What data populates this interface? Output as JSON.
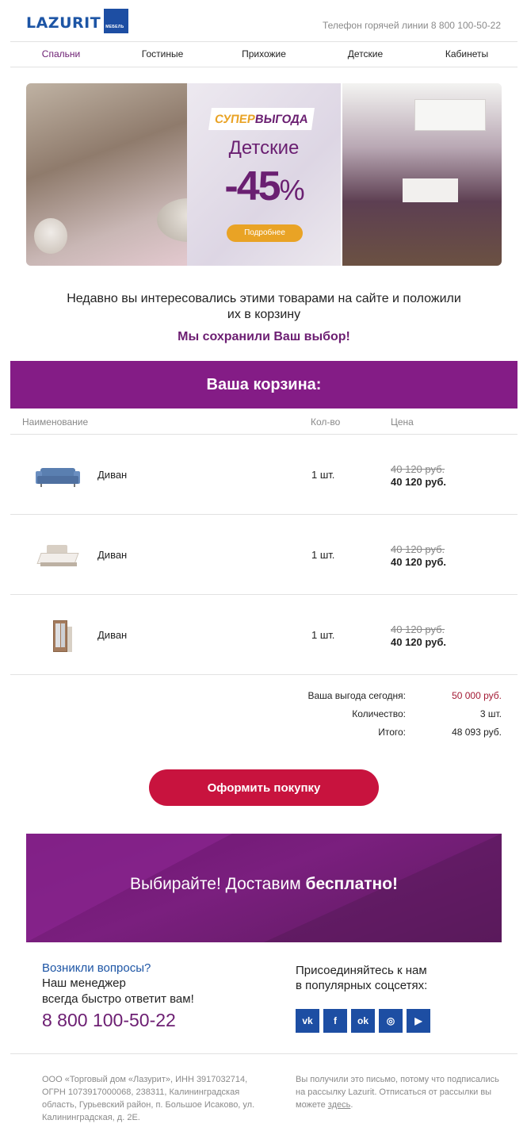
{
  "header": {
    "logo_text": "LAZURIT",
    "logo_sub": "МЕБЕЛЬ",
    "hotline": "Телефон горячей линии 8 800 100-50-22"
  },
  "nav": {
    "items": [
      "Спальни",
      "Гостиные",
      "Прихожие",
      "Детские",
      "Кабинеты"
    ]
  },
  "banner": {
    "tag_part1": "СУПЕР",
    "tag_part2": "ВЫГОДА",
    "title": "Детские",
    "discount": "-45",
    "percent": "%",
    "button": "Подробнее"
  },
  "intro": {
    "text": "Недавно вы интересовались этими товарами на сайте и положили их в корзину",
    "saved": "Мы сохранили Ваш выбор!"
  },
  "cart": {
    "title": "Ваша корзина:",
    "columns": {
      "name": "Наименование",
      "qty": "Кол-во",
      "price": "Цена"
    },
    "items": [
      {
        "name": "Диван",
        "qty": "1 шт.",
        "old_price": "40 120 руб.",
        "price": "40 120 руб.",
        "icon": "sofa-icon"
      },
      {
        "name": "Диван",
        "qty": "1 шт.",
        "old_price": "40 120 руб.",
        "price": "40 120 руб.",
        "icon": "bed-icon"
      },
      {
        "name": "Диван",
        "qty": "1 шт.",
        "old_price": "40 120 руб.",
        "price": "40 120 руб.",
        "icon": "wardrobe-icon"
      }
    ],
    "summary": {
      "benefit_label": "Ваша выгода сегодня:",
      "benefit_value": "50 000 руб.",
      "count_label": "Количество:",
      "count_value": "3 шт.",
      "total_label": "Итого:",
      "total_value": "48 093 руб."
    },
    "buy_button": "Оформить покупку"
  },
  "delivery": {
    "text": "Выбирайте! Доставим ",
    "bold": "бесплатно!"
  },
  "contacts": {
    "title": "Возникли вопросы?",
    "line1": "Наш менеджер",
    "line2": "всегда быстро ответит вам!",
    "phone": "8 800 100-50-22"
  },
  "social": {
    "title_line1": "Присоединяйтесь к нам",
    "title_line2": "в популярных соцсетях:",
    "icons": [
      "vk-icon",
      "facebook-icon",
      "odnoklassniki-icon",
      "instagram-icon",
      "youtube-icon"
    ],
    "icon_glyphs": [
      "vk",
      "f",
      "ok",
      "◎",
      "▶"
    ]
  },
  "footer": {
    "legal": "ООО «Торговый дом «Лазурит», ИНН 3917032714, ОГРН 1073917000068, 238311, Калининградская область, Гурьевский район, п. Большое Исаково, ул. Калининградская, д. 2Е.",
    "unsub_text": "Вы получили это письмо, потому что подписались на рассылку Lazurit. Отписаться от рассылки вы можете ",
    "unsub_link": "здесь",
    "unsub_end": "."
  },
  "colors": {
    "brand_blue": "#1d55a5",
    "brand_purple": "#841c86",
    "accent_orange": "#e9a325",
    "cta_red": "#c8133e",
    "benefit_red": "#a31a34"
  }
}
